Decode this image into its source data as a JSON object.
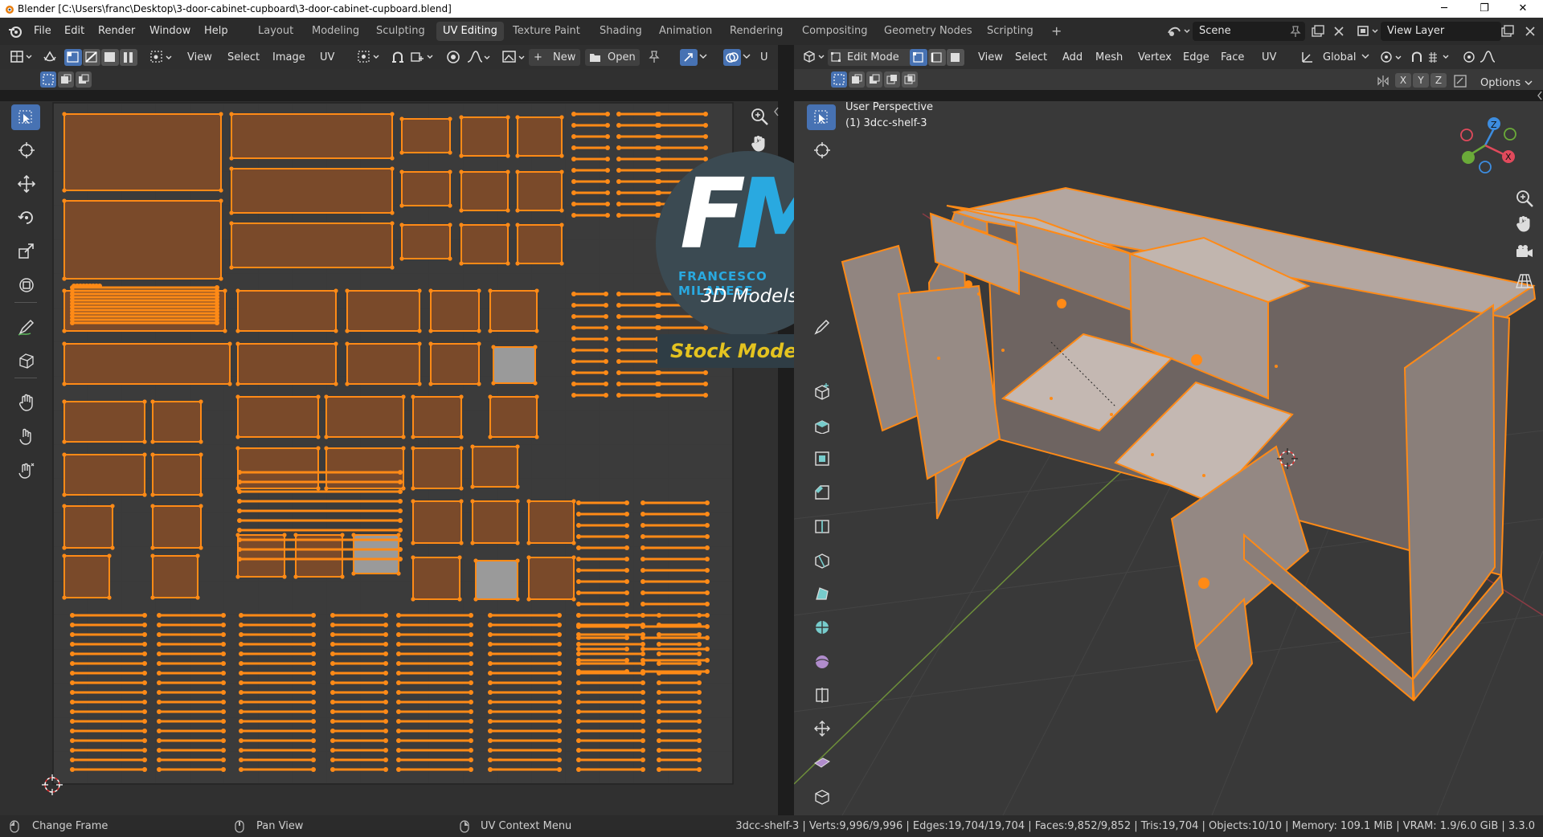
{
  "window": {
    "title": "Blender [C:\\Users\\franc\\Desktop\\3-door-cabinet-cupboard\\3-door-cabinet-cupboard.blend]",
    "minimize": "─",
    "restore": "❐",
    "close": "✕"
  },
  "menu": [
    "File",
    "Edit",
    "Render",
    "Window",
    "Help"
  ],
  "workspaces": [
    "Layout",
    "Modeling",
    "Sculpting",
    "UV Editing",
    "Texture Paint",
    "Shading",
    "Animation",
    "Rendering",
    "Compositing",
    "Geometry Nodes",
    "Scripting"
  ],
  "active_workspace": "UV Editing",
  "add_workspace": "+",
  "scene": {
    "value": "Scene"
  },
  "view_layer": {
    "value": "View Layer"
  },
  "uv_header": {
    "view": "View",
    "select": "Select",
    "image": "Image",
    "uv": "UV",
    "new": "New",
    "open": "Open",
    "truncated": "U"
  },
  "v3d_header": {
    "mode": "Edit Mode",
    "view": "View",
    "select": "Select",
    "add": "Add",
    "mesh": "Mesh",
    "vertex": "Vertex",
    "edge": "Edge",
    "face": "Face",
    "uv": "UV",
    "orientation": "Global",
    "x": "X",
    "y": "Y",
    "z": "Z",
    "options": "Options"
  },
  "viewport": {
    "perspective": "User Perspective",
    "object": "(1) 3dcc-shelf-3",
    "gizmo": {
      "z": "Z",
      "x": "X"
    }
  },
  "watermark": {
    "letters_f": "F",
    "letters_m": "M",
    "name": "FRANCESCO MILANESE",
    "tag": "3D Models",
    "banner": "Stock Models"
  },
  "status": {
    "left": "Change Frame",
    "middle": "Pan View",
    "right": "UV Context Menu",
    "stats": "3dcc-shelf-3 | Verts:9,996/9,996 | Edges:19,704/19,704 | Faces:9,852/9,852 | Tris:19,704 | Objects:10/10 | Memory: 109.1 MiB | VRAM: 1.9/6.0 GiB | 3.3.0"
  },
  "colors": {
    "accent_blue": "#4772b3",
    "selection_orange": "#ff8a16",
    "uv_island_fill": "#7a4a2a",
    "mesh_surface": "#a99b95"
  }
}
